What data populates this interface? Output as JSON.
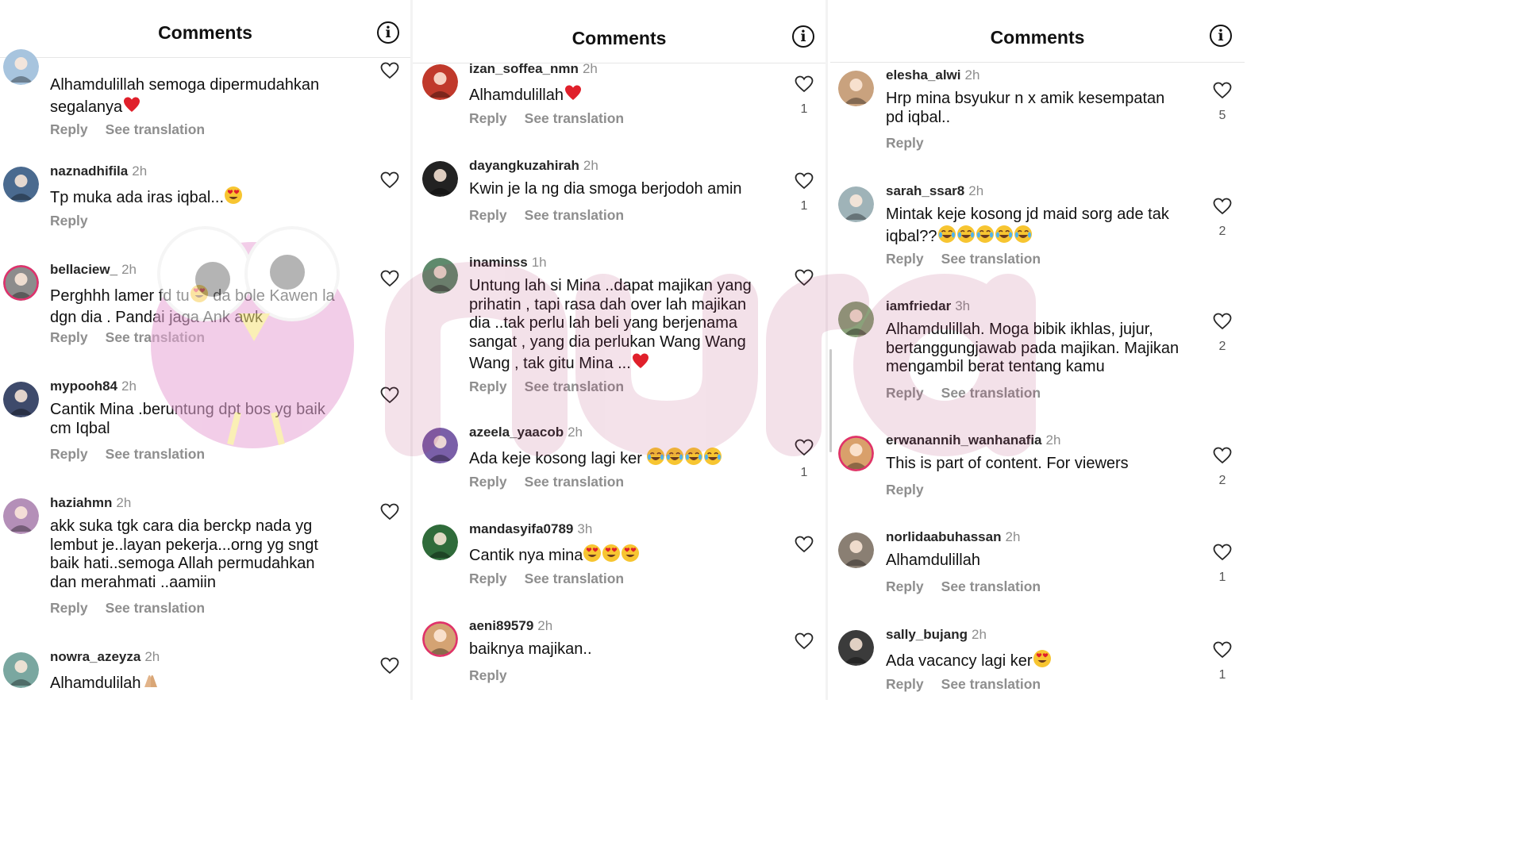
{
  "labels": {
    "reply": "Reply",
    "see_translation": "See translation"
  },
  "colors": {
    "like_heart": "#262626",
    "ring_story": "#e1306c",
    "watermark_pink": "#e8a6d6"
  },
  "panels": [
    {
      "title": "Comments",
      "comments": [
        {
          "username": "",
          "time": "",
          "lines": [
            "Alhamdulillah semoga dipermudahkan",
            "segalanya"
          ],
          "emoji_after": [
            "red-heart"
          ],
          "translation": true,
          "likes": "",
          "avatar_color": "#a7c4de"
        },
        {
          "username": "naznadhifila",
          "time": "2h",
          "lines": [
            "Tp muka ada iras iqbal..."
          ],
          "emoji_after": [
            "heart-eyes"
          ],
          "translation": false,
          "likes": "",
          "avatar_color": "#4a6a8f"
        },
        {
          "username": "bellaciew_",
          "time": "2h",
          "lines": [
            "Perghhh lamer fd tu",
            "dgn dia . Pandai jaga Ank awk"
          ],
          "inline_emoji": "heart-eyes",
          "line0_tail": " da bole Kawen la",
          "translation": true,
          "likes": "",
          "avatar_color": "#8c8c8c",
          "ring": true
        },
        {
          "username": "mypooh84",
          "time": "2h",
          "lines": [
            "Cantik Mina .beruntung dpt bos yg baik",
            "cm Iqbal"
          ],
          "translation": true,
          "likes": "",
          "avatar_color": "#3e4a6b"
        },
        {
          "username": "haziahmn",
          "time": "2h",
          "lines": [
            "akk suka tgk cara dia berckp nada yg",
            "lembut je..layan pekerja...orng yg sngt",
            "baik hati..semoga Allah permudahkan",
            "dan merahmati ..aamiin"
          ],
          "translation": true,
          "likes": "",
          "avatar_color": "#b48fb8"
        },
        {
          "username": "nowra_azeyza",
          "time": "2h",
          "lines": [
            "Alhamdulilah"
          ],
          "emoji_after": [
            "praying-hands"
          ],
          "translation": false,
          "likes": "",
          "avatar_color": "#7aa7a0"
        }
      ]
    },
    {
      "title": "Comments",
      "comments": [
        {
          "username": "izan_soffea_nmn",
          "time": "2h",
          "lines": [
            "Alhamdulillah"
          ],
          "emoji_after": [
            "red-heart"
          ],
          "translation": true,
          "likes": "1",
          "avatar_color": "#c0392b"
        },
        {
          "username": "dayangkuzahirah",
          "time": "2h",
          "lines": [
            "Kwin je la ng dia smoga berjodoh amin"
          ],
          "translation": true,
          "likes": "1",
          "avatar_color": "#222222"
        },
        {
          "username": "inaminss",
          "time": "1h",
          "lines": [
            "Untung lah si Mina ..dapat majikan yang",
            "prihatin , tapi rasa dah over lah majikan",
            "dia ..tak perlu lah beli yang berjenama",
            "sangat , yang dia perlukan Wang Wang",
            "Wang , tak gitu Mina ..."
          ],
          "emoji_after": [
            "red-heart"
          ],
          "translation": true,
          "likes": "",
          "avatar_color": "#5f8a6c"
        },
        {
          "username": "azeela_yaacob",
          "time": "2h",
          "lines": [
            "Ada keje kosong lagi ker "
          ],
          "emoji_after": [
            "joy",
            "joy",
            "joy",
            "joy"
          ],
          "translation": true,
          "likes": "1",
          "avatar_color": "#7a5fa8"
        },
        {
          "username": "mandasyifa0789",
          "time": "3h",
          "lines": [
            "Cantik nya mina"
          ],
          "emoji_after": [
            "heart-eyes",
            "heart-eyes",
            "heart-eyes"
          ],
          "translation": true,
          "likes": "",
          "avatar_color": "#2f6b3a"
        },
        {
          "username": "aeni89579",
          "time": "2h",
          "lines": [
            "baiknya majikan.."
          ],
          "translation": false,
          "likes": "",
          "avatar_color": "#d4a373",
          "ring": true
        }
      ]
    },
    {
      "title": "Comments",
      "comments": [
        {
          "username": "elesha_alwi",
          "time": "2h",
          "lines": [
            "Hrp mina bsyukur n x amik kesempatan",
            "pd iqbal.."
          ],
          "translation": false,
          "likes": "5",
          "avatar_color": "#c9a27e"
        },
        {
          "username": "sarah_ssar8",
          "time": "2h",
          "lines": [
            "Mintak keje kosong jd maid sorg ade tak",
            "iqbal??"
          ],
          "emoji_after": [
            "joy",
            "joy",
            "joy",
            "joy",
            "joy"
          ],
          "translation": true,
          "likes": "2",
          "avatar_color": "#9fb3b8"
        },
        {
          "username": "iamfriedar",
          "time": "3h",
          "lines": [
            "Alhamdulillah. Moga bibik ikhlas, jujur,",
            "bertanggungjawab pada majikan. Majikan",
            "mengambil berat tentang kamu"
          ],
          "translation": true,
          "likes": "2",
          "avatar_color": "#8aa17a"
        },
        {
          "username": "erwanannih_wanhanafia",
          "time": "2h",
          "lines": [
            "This is part of content. For viewers"
          ],
          "translation": false,
          "likes": "2",
          "avatar_color": "#d9a06b",
          "ring": true
        },
        {
          "username": "norlidaabuhassan",
          "time": "2h",
          "lines": [
            "Alhamdulillah"
          ],
          "translation": true,
          "likes": "1",
          "avatar_color": "#8a7f73"
        },
        {
          "username": "sally_bujang",
          "time": "2h",
          "lines": [
            "Ada vacancy lagi ker"
          ],
          "emoji_after": [
            "heart-eyes"
          ],
          "translation": true,
          "likes": "1",
          "avatar_color": "#3b3b3b"
        }
      ]
    }
  ]
}
